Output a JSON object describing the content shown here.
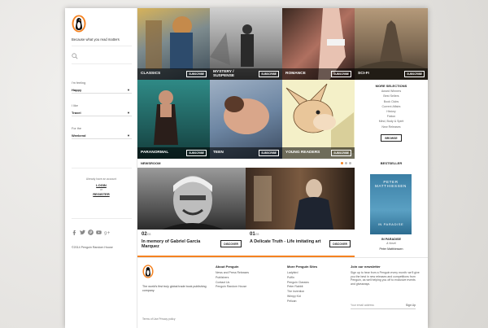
{
  "sidebar": {
    "tagline": "Because what you read matters",
    "filters": [
      {
        "label": "I'm feeling",
        "value": "Happy"
      },
      {
        "label": "I like",
        "value": "Travel"
      },
      {
        "label": "For the",
        "value": "Weekend"
      }
    ],
    "account_question": "Already have an account",
    "login": "LOGIN",
    "or": "or",
    "register": "REGISTER",
    "copyright": "©2014 Penguin Random House"
  },
  "categories": [
    {
      "label": "CLASSICS",
      "button": "SUBSCRIBE"
    },
    {
      "label": "MYSTERY / SUSPENSE",
      "button": "SUBSCRIBE"
    },
    {
      "label": "ROMANCE",
      "button": "SUBSCRIBE"
    },
    {
      "label": "SCI-FI",
      "button": "SUBSCRIBE"
    },
    {
      "label": "PARANORMAL",
      "button": "SUBSCRIBE"
    },
    {
      "label": "TEEN",
      "button": "SUBSCRIBE"
    },
    {
      "label": "YOUNG READERS",
      "button": "SUBSCRIBE"
    }
  ],
  "more_selections": {
    "title": "MORE SELECTIONS",
    "items": [
      "Award Winners",
      "Best Sellers",
      "Book Clubs",
      "Current Affairs",
      "History",
      "Fiction",
      "Mind, Body & Spirit",
      "New Releases"
    ],
    "button": "BROWSE"
  },
  "newsroom": {
    "title": "NEWSROOM",
    "stories": [
      {
        "num": "02",
        "total": "/03",
        "title": "In memory of Gabriel Garcia Marquez",
        "button": "DISCOVER"
      },
      {
        "num": "01",
        "total": "/03",
        "title": "A Delicate Truth - Life imitating art",
        "button": "DISCOVER"
      }
    ]
  },
  "bestseller": {
    "title": "BESTSELLER",
    "cover_author": "PETER MATTHIESSEN",
    "cover_title": "IN PARADISE",
    "book_title": "IN PARADISE",
    "book_subtitle": "A Novel",
    "book_author": "Peter Matthiessen"
  },
  "footer": {
    "desc": "The world's first truly global trade book publishing company.",
    "terms": "Terms of Use    Privacy policy",
    "about": {
      "title": "About Penguin",
      "links": [
        "News and Press Releases",
        "Publishers",
        "Contact Us",
        "Penguin Random House"
      ]
    },
    "sites": {
      "title": "More Penguin Sites",
      "links": [
        "Ladybird",
        "Puffin",
        "Penguin Classics",
        "Peter Rabbit",
        "The Invention",
        "Wimpy Kid",
        "Pelican"
      ]
    },
    "newsletter": {
      "title": "Join our newsletter",
      "text": "Sign up to hear from a Penguin every month: we'll give you the best in new releases and competitions from Penguin, as well helping you off to exclusive events and giveaways.",
      "placeholder": "Your email address",
      "button": "Sign Up"
    }
  },
  "colors": {
    "accent": "#f58220"
  }
}
